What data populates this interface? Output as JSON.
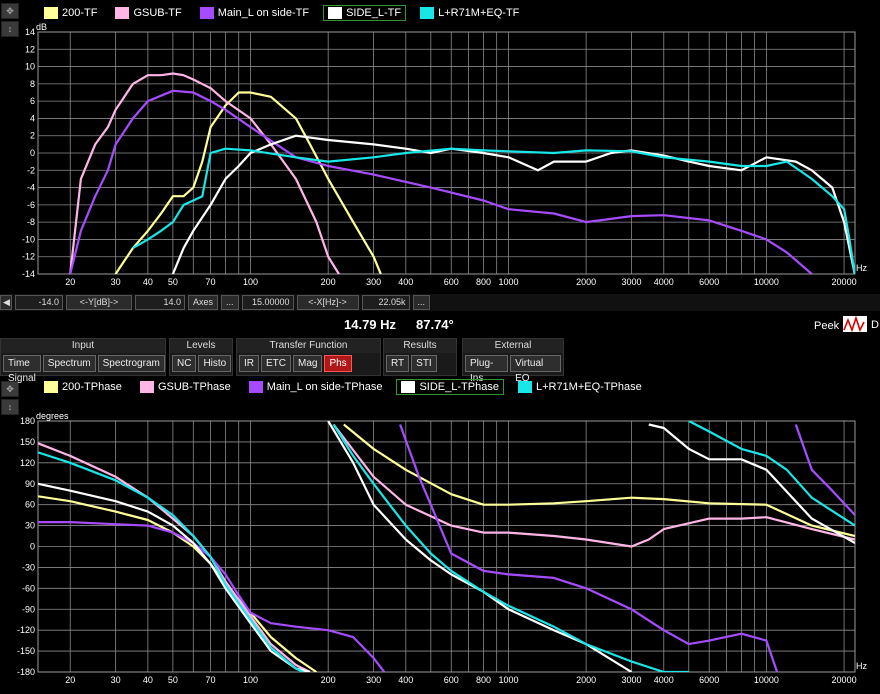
{
  "top_legend": [
    {
      "label": "200-TF",
      "color": "#ffff99"
    },
    {
      "label": "GSUB-TF",
      "color": "#ffb6e6"
    },
    {
      "label": "Main_L on side-TF",
      "color": "#a64cff"
    },
    {
      "label": "SIDE_L-TF",
      "color": "#ffffff",
      "selected": true
    },
    {
      "label": "L+R71M+EQ-TF",
      "color": "#19e6e6"
    }
  ],
  "bottom_legend": [
    {
      "label": "200-TPhase",
      "color": "#ffff99"
    },
    {
      "label": "GSUB-TPhase",
      "color": "#ffb6e6"
    },
    {
      "label": "Main_L on side-TPhase",
      "color": "#a64cff"
    },
    {
      "label": "SIDE_L-TPhase",
      "color": "#ffffff",
      "selected": true
    },
    {
      "label": "L+R71M+EQ-TPhase",
      "color": "#19e6e6"
    }
  ],
  "axis_bar": {
    "ymin": "-14.0",
    "ylabel_btn": "<-Y[dB]->",
    "ymax": "14.0",
    "axes_btn": "Axes",
    "dots_btn": "...",
    "xmin": "15.00000",
    "xlabel_btn": "<-X[Hz]->",
    "xmax": "22.05k",
    "dots2_btn": "..."
  },
  "readout": {
    "freq": "14.79 Hz",
    "phase": "87.74°",
    "peek": "Peek",
    "d": "D"
  },
  "toolbar": {
    "input": {
      "title": "Input",
      "buttons": [
        "Time Signal",
        "Spectrum",
        "Spectrogram"
      ]
    },
    "levels": {
      "title": "Levels",
      "buttons": [
        "NC",
        "Histo"
      ]
    },
    "transfer": {
      "title": "Transfer Function",
      "buttons": [
        "IR",
        "ETC",
        "Mag",
        "Phs"
      ],
      "active": "Phs"
    },
    "results": {
      "title": "Results",
      "buttons": [
        "RT",
        "STI"
      ]
    },
    "external": {
      "title": "External",
      "buttons": [
        "Plug-Ins",
        "Virtual EQ"
      ]
    }
  },
  "chart_data": [
    {
      "type": "line",
      "ylabel": "dB",
      "xlabel": "Hz",
      "xscale": "log",
      "xlim": [
        15,
        22050
      ],
      "ylim": [
        -14,
        14
      ],
      "y_ticks": [
        14,
        12,
        10,
        8,
        6,
        4,
        2,
        0,
        -2,
        -4,
        -6,
        -8,
        -10,
        -12,
        -14
      ],
      "x_ticks": [
        20,
        30,
        40,
        50,
        70,
        100,
        200,
        300,
        400,
        600,
        800,
        1000,
        2000,
        3000,
        4000,
        6000,
        10000,
        20000
      ],
      "x_tick_labels": [
        "20",
        "30",
        "40",
        "50",
        "70",
        "100",
        "200",
        "300",
        "400",
        "600",
        "800",
        "1000",
        "2000",
        "3000",
        "4000",
        "6000",
        "10000",
        "20000"
      ],
      "grid": true,
      "series": [
        {
          "name": "200-TF",
          "color": "#ffff99",
          "x": [
            30,
            35,
            40,
            45,
            50,
            55,
            60,
            65,
            70,
            80,
            90,
            100,
            120,
            150,
            170,
            200,
            250,
            300,
            320
          ],
          "y": [
            -14,
            -11,
            -9,
            -7,
            -5,
            -5,
            -4,
            -1,
            3,
            5.5,
            7,
            7,
            6.5,
            4,
            1,
            -3,
            -8,
            -12,
            -14
          ]
        },
        {
          "name": "GSUB-TF",
          "color": "#ffb6e6",
          "x": [
            20,
            22,
            25,
            28,
            30,
            35,
            40,
            45,
            50,
            55,
            60,
            70,
            80,
            100,
            120,
            150,
            180,
            200,
            220
          ],
          "y": [
            -14,
            -3,
            1,
            3,
            5,
            8,
            9,
            9,
            9.2,
            9,
            8.5,
            7.5,
            6,
            4,
            1,
            -3,
            -8,
            -12,
            -14
          ]
        },
        {
          "name": "Main_L on side-TF",
          "color": "#a64cff",
          "x": [
            20,
            22,
            25,
            28,
            30,
            35,
            40,
            50,
            60,
            70,
            80,
            100,
            150,
            200,
            300,
            500,
            800,
            1000,
            1500,
            2000,
            3000,
            4000,
            6000,
            8000,
            10000,
            12000,
            15000
          ],
          "y": [
            -14,
            -9,
            -5,
            -2,
            1,
            4,
            6,
            7.2,
            7,
            6,
            5,
            3,
            -0.5,
            -1.5,
            -2.5,
            -4,
            -5.5,
            -6.5,
            -7,
            -8,
            -7.3,
            -7.2,
            -7.8,
            -9,
            -10,
            -11.5,
            -14
          ]
        },
        {
          "name": "SIDE_L-TF",
          "color": "#ffffff",
          "x": [
            50,
            55,
            60,
            70,
            80,
            90,
            100,
            120,
            150,
            200,
            300,
            400,
            500,
            600,
            800,
            1000,
            1300,
            1500,
            2000,
            2500,
            3000,
            4000,
            5000,
            6000,
            8000,
            10000,
            13000,
            15000,
            18000,
            20000,
            22000
          ],
          "y": [
            -14,
            -11,
            -9,
            -6,
            -3,
            -1.5,
            0,
            1,
            2,
            1.5,
            1,
            0.5,
            0,
            0.5,
            0,
            -0.5,
            -2,
            -1,
            -1,
            0,
            0.3,
            -0.3,
            -1,
            -1.5,
            -2,
            -0.5,
            -1,
            -2,
            -4,
            -8,
            -14
          ]
        },
        {
          "name": "L+R71M+EQ-TF",
          "color": "#19e6e6",
          "x": [
            35,
            40,
            45,
            50,
            55,
            60,
            65,
            70,
            80,
            100,
            150,
            200,
            300,
            400,
            600,
            800,
            1000,
            1500,
            2000,
            3000,
            4000,
            6000,
            8000,
            10000,
            12000,
            15000,
            18000,
            20000,
            21000,
            22000
          ],
          "y": [
            -11,
            -10,
            -9,
            -8,
            -6,
            -5.5,
            -5,
            0,
            0.5,
            0.3,
            -0.5,
            -1,
            -0.5,
            0,
            0.5,
            0.3,
            0.2,
            0,
            0.3,
            0.2,
            -0.5,
            -1,
            -1.5,
            -1.5,
            -1,
            -3,
            -5,
            -6.5,
            -10,
            -14
          ]
        }
      ]
    },
    {
      "type": "line",
      "ylabel": "degrees",
      "xlabel": "Hz",
      "xscale": "log",
      "xlim": [
        15,
        22050
      ],
      "ylim": [
        -180,
        180
      ],
      "y_ticks": [
        180,
        150,
        120,
        90,
        60,
        30,
        0,
        -30,
        -60,
        -90,
        -120,
        -150,
        -180
      ],
      "x_ticks": [
        20,
        30,
        40,
        50,
        70,
        100,
        200,
        300,
        400,
        600,
        800,
        1000,
        2000,
        3000,
        4000,
        6000,
        10000,
        20000
      ],
      "x_tick_labels": [
        "20",
        "30",
        "40",
        "50",
        "70",
        "100",
        "200",
        "300",
        "400",
        "600",
        "800",
        "1000",
        "2000",
        "3000",
        "4000",
        "6000",
        "10000",
        "20000"
      ],
      "grid": true,
      "series": [
        {
          "name": "200-TPhase",
          "color": "#ffff99",
          "segments": [
            {
              "x": [
                15,
                20,
                30,
                40,
                50,
                60,
                70,
                80,
                100,
                120,
                150,
                180
              ],
              "y": [
                72,
                65,
                50,
                38,
                20,
                0,
                -25,
                -55,
                -95,
                -130,
                -160,
                -180
              ]
            },
            {
              "x": [
                230,
                300,
                400,
                600,
                800,
                1000,
                1500,
                2000,
                3000,
                4000,
                6000,
                10000,
                15000,
                22050
              ],
              "y": [
                175,
                140,
                110,
                75,
                60,
                60,
                62,
                65,
                70,
                68,
                62,
                60,
                30,
                15
              ]
            }
          ]
        },
        {
          "name": "GSUB-TPhase",
          "color": "#ffb6e6",
          "segments": [
            {
              "x": [
                15,
                20,
                30,
                40,
                50,
                60,
                70,
                80,
                100,
                120,
                150,
                170
              ],
              "y": [
                148,
                130,
                100,
                70,
                40,
                15,
                -15,
                -50,
                -100,
                -140,
                -170,
                -180
              ]
            },
            {
              "x": [
                210,
                300,
                400,
                600,
                800,
                1000,
                1500,
                2000,
                3000,
                3500,
                4000,
                6000,
                8000,
                10000,
                15000,
                22050
              ],
              "y": [
                175,
                100,
                60,
                30,
                20,
                20,
                15,
                10,
                0,
                10,
                25,
                40,
                40,
                42,
                25,
                10
              ]
            }
          ]
        },
        {
          "name": "Main_L on side-TPhase",
          "color": "#a64cff",
          "segments": [
            {
              "x": [
                15,
                20,
                30,
                40,
                50,
                60,
                70,
                80,
                90,
                100,
                120,
                150,
                200,
                250,
                300,
                330
              ],
              "y": [
                35,
                35,
                32,
                30,
                20,
                5,
                -15,
                -40,
                -70,
                -95,
                -110,
                -115,
                -120,
                -130,
                -160,
                -180
              ]
            },
            {
              "x": [
                380,
                450,
                500,
                600,
                800,
                1000,
                1500,
                2000,
                3000,
                4000,
                5000,
                6000,
                8000,
                10000,
                11000
              ],
              "y": [
                175,
                100,
                60,
                -10,
                -35,
                -40,
                -45,
                -60,
                -90,
                -120,
                -140,
                -135,
                -125,
                -135,
                -180
              ]
            },
            {
              "x": [
                13000,
                15000,
                18000,
                22050
              ],
              "y": [
                175,
                110,
                80,
                45
              ]
            }
          ]
        },
        {
          "name": "SIDE_L-TPhase",
          "color": "#ffffff",
          "segments": [
            {
              "x": [
                15,
                20,
                30,
                40,
                50,
                60,
                70,
                80,
                100,
                120,
                150,
                170
              ],
              "y": [
                90,
                80,
                65,
                50,
                30,
                5,
                -25,
                -60,
                -110,
                -150,
                -175,
                -180
              ]
            },
            {
              "x": [
                200,
                250,
                300,
                400,
                500,
                600,
                800,
                1000,
                1500,
                2000,
                3000
              ],
              "y": [
                180,
                120,
                60,
                10,
                -20,
                -40,
                -65,
                -90,
                -120,
                -140,
                -180
              ]
            },
            {
              "x": [
                3500,
                4000,
                5000,
                6000,
                8000,
                10000,
                15000,
                22050
              ],
              "y": [
                175,
                170,
                140,
                125,
                125,
                110,
                40,
                5
              ]
            }
          ]
        },
        {
          "name": "L+R71M+EQ-TPhase",
          "color": "#19e6e6",
          "segments": [
            {
              "x": [
                15,
                20,
                30,
                40,
                50,
                60,
                70,
                80,
                100,
                120,
                150,
                160
              ],
              "y": [
                135,
                120,
                95,
                70,
                45,
                15,
                -15,
                -55,
                -105,
                -145,
                -175,
                -180
              ]
            },
            {
              "x": [
                210,
                250,
                300,
                400,
                500,
                600,
                800,
                1000,
                1500,
                2000,
                3000,
                4000,
                5000
              ],
              "y": [
                175,
                130,
                90,
                30,
                -10,
                -35,
                -65,
                -85,
                -115,
                -140,
                -165,
                -180,
                -180
              ]
            },
            {
              "x": [
                5000,
                6000,
                8000,
                10000,
                12000,
                15000,
                22050
              ],
              "y": [
                180,
                165,
                140,
                130,
                110,
                70,
                30
              ]
            }
          ]
        }
      ]
    }
  ]
}
